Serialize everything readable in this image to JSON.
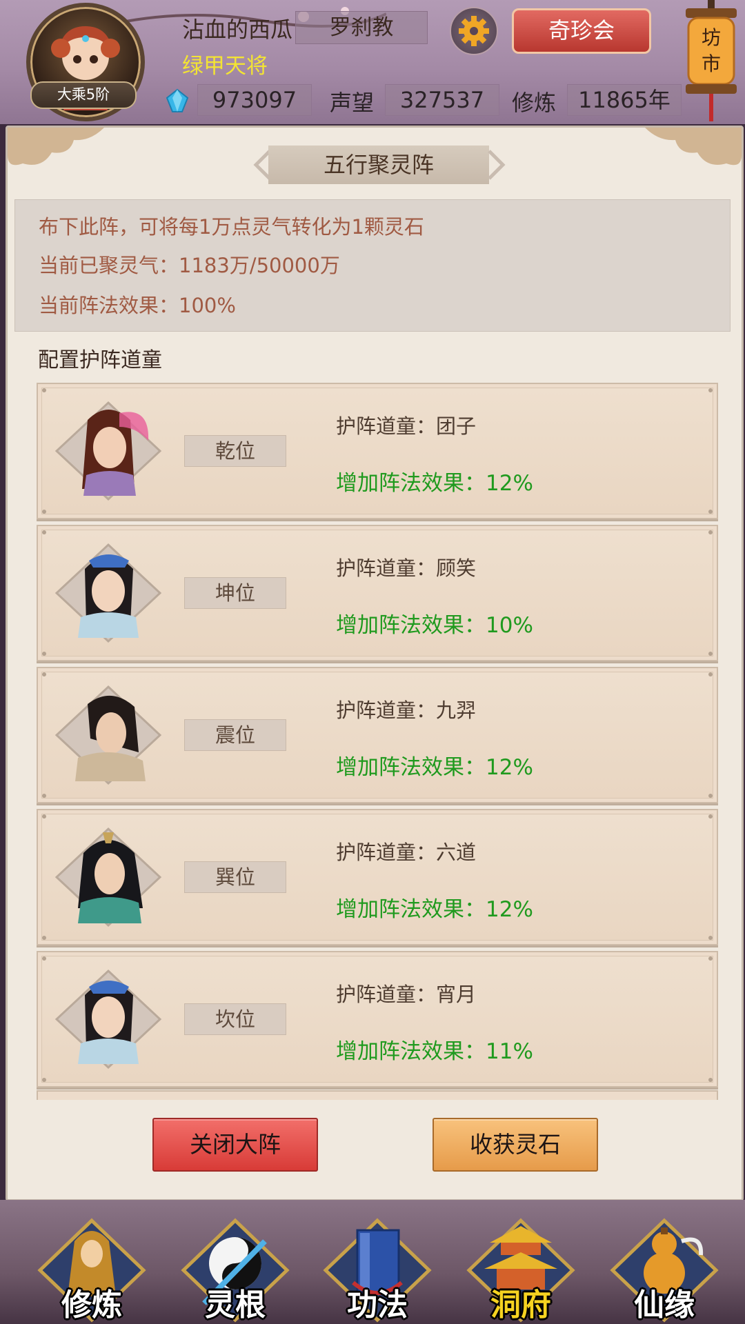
{
  "header": {
    "player_name": "沾血的西瓜",
    "sect": "罗刹教",
    "shop_button": "奇珍会",
    "title": "绿甲天将",
    "rank_badge": "大乘5阶",
    "gems": "973097",
    "reputation_label": "声望",
    "reputation": "327537",
    "cultivation_label": "修炼",
    "cultivation": "11865年",
    "market_sign": "坊市"
  },
  "panel": {
    "title": "五行聚灵阵",
    "info_lines": [
      "布下此阵，可将每1万点灵气转化为1颗灵石",
      "当前已聚灵气：1183万/50000万",
      "当前阵法效果：100%"
    ],
    "section_label": "配置护阵道童",
    "slots": [
      {
        "position": "乾位",
        "guard": "护阵道童：团子",
        "effect": "增加阵法效果：12%"
      },
      {
        "position": "坤位",
        "guard": "护阵道童：顾笑",
        "effect": "增加阵法效果：10%"
      },
      {
        "position": "震位",
        "guard": "护阵道童：九羿",
        "effect": "增加阵法效果：12%"
      },
      {
        "position": "巽位",
        "guard": "护阵道童：六道",
        "effect": "增加阵法效果：12%"
      },
      {
        "position": "坎位",
        "guard": "护阵道童：宵月",
        "effect": "增加阵法效果：11%"
      }
    ],
    "close_button": "关闭大阵",
    "collect_button": "收获灵石"
  },
  "nav": [
    {
      "label": "修炼",
      "icon": "monk-icon"
    },
    {
      "label": "灵根",
      "icon": "yinyang-sword-icon"
    },
    {
      "label": "功法",
      "icon": "book-icon"
    },
    {
      "label": "洞府",
      "icon": "pagoda-icon",
      "active": true
    },
    {
      "label": "仙缘",
      "icon": "gourd-icon"
    }
  ],
  "colors": {
    "effect_green": "#1f9a1e",
    "info_text": "#a05a43",
    "title_gold": "#f3e433",
    "active_nav": "#f6d320"
  }
}
